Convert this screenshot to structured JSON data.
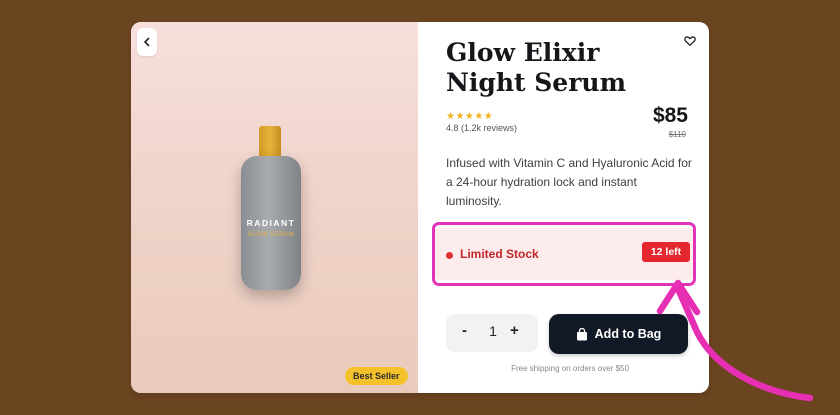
{
  "product": {
    "name": "Glow Elixir Night Serum",
    "stars": "★★★★★",
    "rating_text": "4.8 (1.2k reviews)",
    "price": "$85",
    "old_price": "$110",
    "description": "Infused with Vitamin C and Hyaluronic Acid for a 24-hour hydration lock and instant luminosity.",
    "bottle_brand": "RADIANT",
    "bottle_sub": "GLOW SERUM",
    "badge": "Best Seller"
  },
  "stock": {
    "label": "Limited Stock",
    "count": "12 left"
  },
  "quantity": {
    "minus": "-",
    "value": "1",
    "plus": "+"
  },
  "actions": {
    "add_to_bag": "Add to Bag"
  },
  "shipping_note": "Free shipping on orders over $50",
  "colors": {
    "background": "#6b4420",
    "accent_dark": "#111826",
    "stock_red": "#e5282e",
    "star_gold": "#f1b21f",
    "highlight_magenta": "#e033b8"
  },
  "icons": {
    "back": "chevron-left-icon",
    "wishlist": "heart-icon",
    "bag": "shopping-bag-icon",
    "annotation": "curved-arrow"
  }
}
